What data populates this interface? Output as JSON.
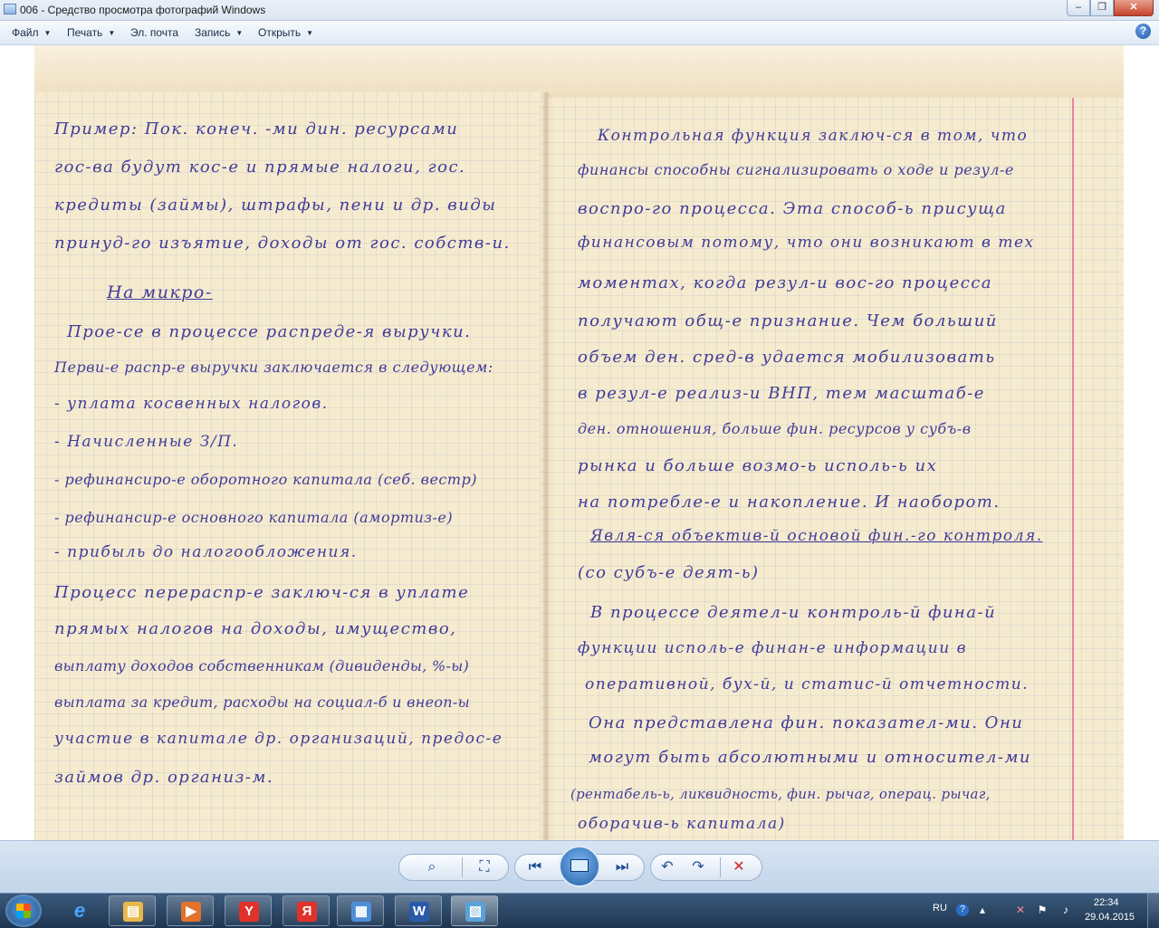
{
  "window": {
    "title": "006 - Средство просмотра фотографий Windows",
    "minimize": "‒",
    "maximize": "❐",
    "close": "✕"
  },
  "menu": {
    "file": "Файл",
    "print": "Печать",
    "email": "Эл. почта",
    "burn": "Запись",
    "open": "Открыть",
    "help": "?"
  },
  "photo": {
    "left_page": [
      "Пример: Пок. конеч. -ми дин. ресурсами",
      "гос-ва будут кос-е и прямые налоги, гос.",
      "кредиты (займы), штрафы, пени и др. виды",
      "принуд-го изъятие, доходы от гос. собств-и.",
      "На микро-",
      "Прое-се в процессе распреде-я выручки.",
      "Перви-е распр-е выручки заключается в следующем:",
      "- уплата косвенных налогов.",
      "- Начисленные З/П.",
      "- рефинансиро-е оборотного капитала (себ. вестр)",
      "- рефинансир-е основного капитала (амортиз-е)",
      "- прибыль до налогообложения.",
      "Процесс перераспр-е заключ-ся в уплате",
      "прямых налогов на доходы, имущество,",
      "выплату доходов собственникам (дивиденды, %-ы)",
      "выплата за кредит, расходы на социал-б и внеоп-ы",
      "участие в капитале др. организаций, предос-е",
      "займов др. организ-м."
    ],
    "right_page": [
      "Контрольная функция заключ-ся в том, что",
      "финансы способны сигнализировать о ходе и резул-е",
      "воспро-го процесса. Эта способ-ь присуща",
      "финансовым потому, что они возникают в тех",
      "моментах, когда резул-и вос-го процесса",
      "получают общ-е признание. Чем больший",
      "объем ден. сред-в удается мобилизовать",
      "в резул-е реализ-и ВНП, тем масштаб-е",
      "ден. отношения, больше фин. ресурсов у субъ-в",
      "рынка и больше возмо-ь исполь-ь их",
      "на потребле-е и накопление. И наоборот.",
      "Явля-ся объектив-й основой фин.-го контроля.",
      "(со субъ-е деят-ь)",
      "В процессе деятел-и контроль-й фина-й",
      "функции исполь-е финан-е информации в",
      "оперативной, бух-й, и статис-й отчетности.",
      "Она представлена фин. показател-ми. Они",
      "могут быть абсолютными и относител-ми",
      "(рентабель-ь, ликвидность, фин. рычаг, операц. рычаг,",
      "оборачив-ь капитала)"
    ]
  },
  "viewer_toolbar": {
    "zoom": "⌕",
    "fit": "⛶",
    "previous": "⏮",
    "slideshow": "",
    "next": "⏭",
    "rotate_ccw": "↶",
    "rotate_cw": "↷",
    "delete": "✕"
  },
  "taskbar": {
    "apps": [
      {
        "name": "explorer",
        "glyph": "▤",
        "color": "#e8b84a"
      },
      {
        "name": "media-player",
        "glyph": "▶",
        "color": "#e2722c"
      },
      {
        "name": "yandex-browser",
        "glyph": "Y",
        "color": "#e0322b"
      },
      {
        "name": "yandex",
        "glyph": "Я",
        "color": "#e0322b"
      },
      {
        "name": "control-panel",
        "glyph": "▦",
        "color": "#4d8fd6"
      },
      {
        "name": "word",
        "glyph": "W",
        "color": "#2b5aa8"
      },
      {
        "name": "photo-viewer",
        "glyph": "▧",
        "color": "#5aa2d8"
      }
    ],
    "language": "RU",
    "time": "22:34",
    "date": "29.04.2015"
  }
}
